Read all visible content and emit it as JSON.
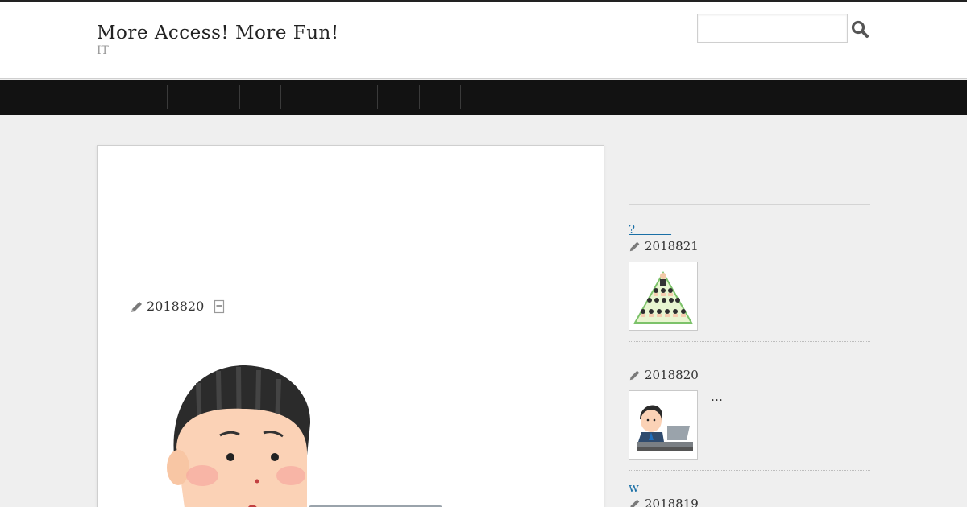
{
  "header": {
    "site_title": "More Access! More Fun!",
    "site_description": "IT",
    "search": {
      "value": "",
      "placeholder": ""
    }
  },
  "nav": {
    "item_count": 8
  },
  "main": {
    "post_date": "2018820"
  },
  "sidebar": {
    "posts": [
      {
        "title": "?　　　",
        "date": "2018821",
        "excerpt": ""
      },
      {
        "title": "",
        "date": "2018820",
        "excerpt": "…"
      },
      {
        "title": "w　　　　　　　　",
        "date": "2018819",
        "excerpt": ""
      }
    ]
  },
  "colors": {
    "nav_bg": "#121212",
    "link": "#1a6fa6",
    "page_bg": "#efefef"
  },
  "icons": [
    "search-icon",
    "pencil-icon",
    "category-icon"
  ]
}
